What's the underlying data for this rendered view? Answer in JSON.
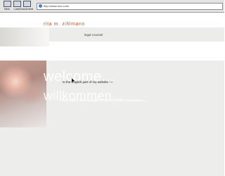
{
  "toolbar": {
    "buttons": [
      {
        "label": "New",
        "icon": "new-page-icon"
      },
      {
        "label": "Load",
        "icon": "load-icon"
      },
      {
        "label": "Document",
        "icon": "document-icon"
      }
    ],
    "url": "http://www.rmz.com/"
  },
  "page": {
    "brand": "rita m. zihlmann",
    "subtitle": "legal counsel",
    "welcome": "welcome...",
    "english_link": "to the English part of my website",
    "english_arrow": ">>",
    "willkommen": "willkommen...",
    "tagline": "«Data Aided willeroplegal! Visionen, Folien and Balance.»"
  },
  "colors": {
    "brand": "#b45a2a",
    "background_gray": "#ededec"
  }
}
